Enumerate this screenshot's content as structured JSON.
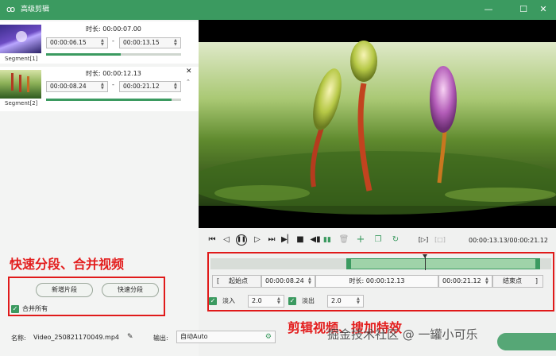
{
  "window": {
    "title": "高级剪辑",
    "logo_glyph": "ꝏ",
    "min_glyph": "—",
    "max_glyph": "☐",
    "close_glyph": "✕"
  },
  "segments": [
    {
      "label": "Segment[1]",
      "duration": "时长: 00:00:07.00",
      "start": "00:00:06.15",
      "end": "00:00:13.15",
      "progress": 0.55
    },
    {
      "label": "Segment[2]",
      "duration": "时长: 00:00:12.13",
      "start": "00:00:08.24",
      "end": "00:00:21.12",
      "progress": 0.93
    }
  ],
  "segment_sep": "-",
  "close_segment_glyph": "✕",
  "left_bottom": {
    "overlay_text": "快速分段、合并视频",
    "add_segment_label": "新增片段",
    "quick_split_label": "快速分段",
    "merge_all_label": "合并所有",
    "merge_all_checked": true
  },
  "output": {
    "name_label": "名称:",
    "name_value": "Video_250821170049.mp4",
    "output_label": "输出:",
    "output_value": "自动Auto"
  },
  "player": {
    "time_display": "00:00:13.13/00:00:21.12",
    "start_btn_label": "起始点",
    "start_value": "00:00:08.24",
    "duration_label": "时长: 00:00:12.13",
    "end_value": "00:00:21.12",
    "end_btn_label": "结束点",
    "fade_in_label": "淡入",
    "fade_in_value": "2.0",
    "fade_out_label": "淡出",
    "fade_out_value": "2.0",
    "bracket_left": "[",
    "bracket_right": "]",
    "playhead_fraction": 0.63
  },
  "overlay_bottom": "剪辑视频、搜加特效",
  "watermark": "掘金技术社区 @ 一罐小可乐",
  "colors": {
    "accent": "#3b9a60",
    "highlight": "#e01a1a"
  }
}
